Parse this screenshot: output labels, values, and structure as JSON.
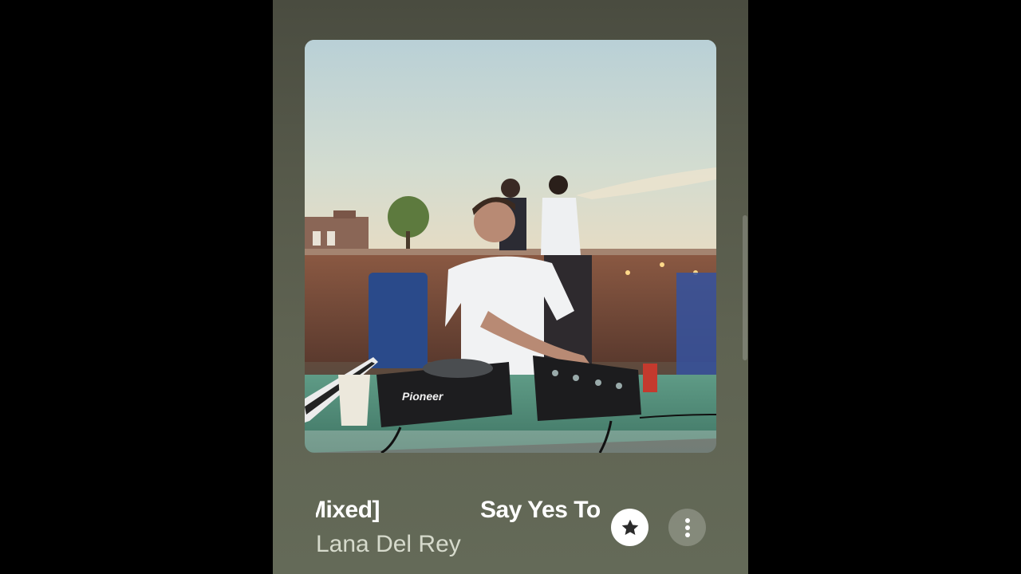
{
  "now_playing": {
    "title_left": "Mixed]",
    "title_right": "Say Yes To",
    "artist": "Lana Del Rey"
  },
  "artwork": {
    "brand_text": "Pioneer"
  },
  "controls": {
    "favorite_icon": "star-icon",
    "more_icon": "more-vertical-icon"
  },
  "colors": {
    "background": "#5a5e4d",
    "title": "#ffffff",
    "artist": "#d6dacc"
  }
}
